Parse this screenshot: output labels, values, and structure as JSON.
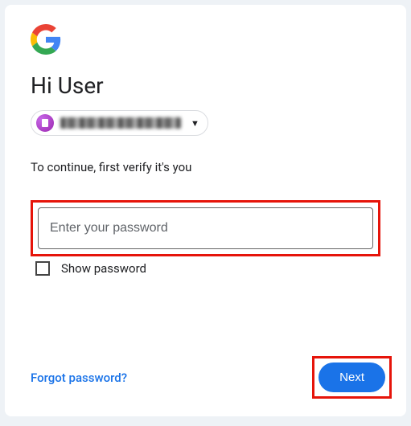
{
  "heading": "Hi User",
  "account": {
    "email_obscured": true
  },
  "subtext": "To continue, first verify it's you",
  "password": {
    "placeholder": "Enter your password",
    "value": ""
  },
  "show_password": {
    "label": "Show password",
    "checked": false
  },
  "forgot_label": "Forgot password?",
  "next_label": "Next",
  "colors": {
    "accent": "#1a73e8",
    "highlight_border": "#e6140a"
  }
}
